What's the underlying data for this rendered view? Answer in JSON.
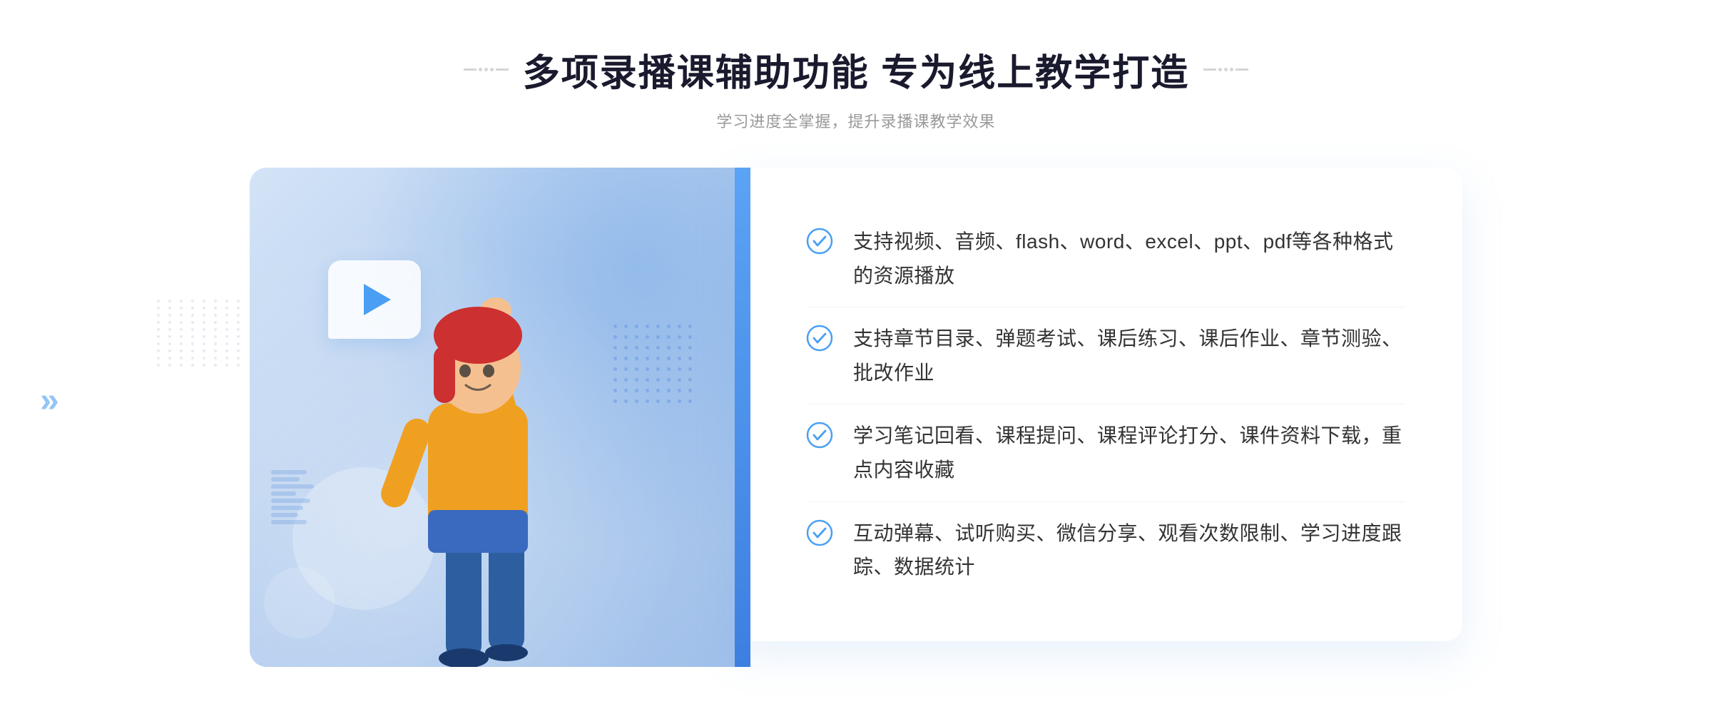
{
  "header": {
    "title": "多项录播课辅助功能 专为线上教学打造",
    "subtitle": "学习进度全掌握，提升录播课教学效果",
    "title_deco_left": "decoration",
    "title_deco_right": "decoration"
  },
  "features": [
    {
      "id": 1,
      "text": "支持视频、音频、flash、word、excel、ppt、pdf等各种格式的资源播放"
    },
    {
      "id": 2,
      "text": "支持章节目录、弹题考试、课后练习、课后作业、章节测验、批改作业"
    },
    {
      "id": 3,
      "text": "学习笔记回看、课程提问、课程评论打分、课件资料下载，重点内容收藏"
    },
    {
      "id": 4,
      "text": "互动弹幕、试听购买、微信分享、观看次数限制、学习进度跟踪、数据统计"
    }
  ],
  "colors": {
    "primary_blue": "#4a9ff5",
    "dark_blue": "#3d7fe0",
    "light_blue_bg": "#c8dff5",
    "text_dark": "#333333",
    "text_light": "#999999",
    "title_color": "#1a1a2e"
  },
  "icons": {
    "play": "▶",
    "check": "check-circle",
    "chevron_left": "«",
    "chevron_right": "»"
  }
}
